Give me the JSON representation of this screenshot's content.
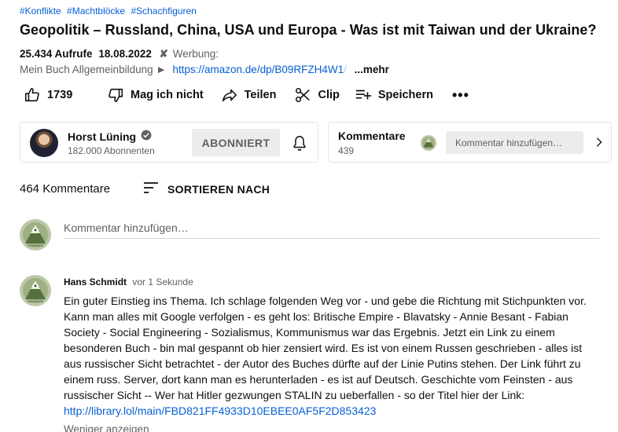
{
  "hashtags": [
    "#Konflikte",
    "#Machtblöcke",
    "#Schachfiguren"
  ],
  "video": {
    "title": "Geopolitik – Russland, China, USA und Europa - Was ist mit Taiwan und der Ukraine?",
    "views": "25.434 Aufrufe",
    "date": "18.08.2022",
    "ad_icon": "✘",
    "ad_label": "Werbung:",
    "desc_prefix": "Mein Buch Allgemeinbildung ►",
    "desc_link": "https://amazon.de/dp/B09RFZH4W1",
    "desc_link_fade": "/",
    "more": "...mehr"
  },
  "actions": {
    "like_count": "1739",
    "dislike_label": "Mag ich nicht",
    "share_label": "Teilen",
    "clip_label": "Clip",
    "save_label": "Speichern",
    "more_label": "•••"
  },
  "channel": {
    "name": "Horst Lüning",
    "subscribers": "182.000 Abonnenten",
    "subscribe_label": "ABONNIERT"
  },
  "comments_panel": {
    "title": "Kommentare",
    "count": "439",
    "input_placeholder": "Kommentar hinzufügen…"
  },
  "comments": {
    "count_title": "464 Kommentare",
    "sort_label": "SORTIEREN NACH",
    "add_placeholder": "Kommentar hinzufügen…",
    "items": [
      {
        "author": "Hans Schmidt",
        "time": "vor 1 Sekunde",
        "lines": [
          "Ein guter Einstieg ins Thema. Ich schlage folgenden Weg vor - und gebe die Richtung mit Stichpunkten vor.",
          "Kann man alles mit Google verfolgen - es geht los: Britische Empire - Blavatsky - Annie Besant - Fabian",
          "Society - Social Engineering - Sozialismus, Kommunismus war das Ergebnis. Jetzt ein Link zu einem",
          "besonderen Buch - bin mal gespannt ob hier zensiert wird. Es ist von einem Russen geschrieben - alles ist",
          "aus russischer Sicht betrachtet - der Autor des Buches dürfte auf der Linie Putins stehen. Der Link führt zu",
          "einem russ. Server, dort kann man es herunterladen - es ist auf Deutsch. Geschichte vom Feinsten - aus",
          "russischer Sicht -- Wer hat Hitler gezwungen STALIN zu ueberfallen - so der Titel hier der Link:"
        ],
        "link": "http://library.lol/main/FBD821FF4933D10EBEE0AF5F2D853423",
        "less_label": "Weniger anzeigen"
      }
    ]
  },
  "colors": {
    "link": "#065fd4",
    "secondary_text": "#606060",
    "button_bg": "#ececec"
  },
  "icons": [
    "like-icon",
    "dislike-icon",
    "share-icon",
    "scissors-icon",
    "playlist-add-icon",
    "more-icon",
    "verified-icon",
    "bell-icon",
    "chevron-right-icon",
    "sort-icon",
    "eye-pyramid-avatar"
  ]
}
